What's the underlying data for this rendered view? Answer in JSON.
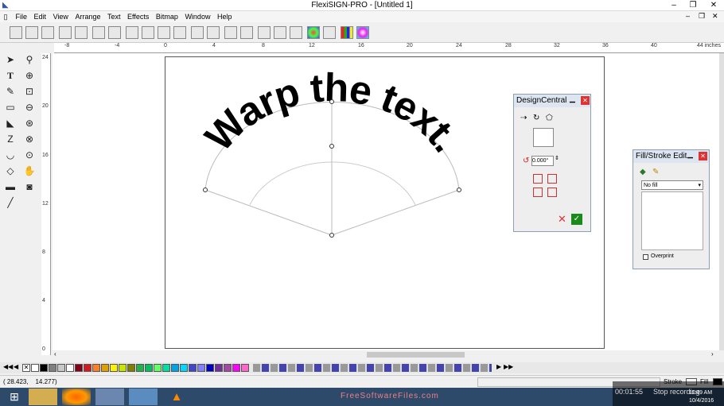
{
  "window": {
    "title": "FlexiSIGN-PRO - [Untitled 1]"
  },
  "menu": [
    "File",
    "Edit",
    "View",
    "Arrange",
    "Text",
    "Effects",
    "Bitmap",
    "Window",
    "Help"
  ],
  "ruler": {
    "top_labels": [
      "-8",
      "-4",
      "0",
      "4",
      "8",
      "12",
      "16",
      "20",
      "24",
      "28",
      "32",
      "36",
      "40",
      "44 inches"
    ],
    "left_labels": [
      "24",
      "20",
      "16",
      "12",
      "8",
      "4",
      "0"
    ]
  },
  "canvas": {
    "warp_text": "Warp the text."
  },
  "design_central": {
    "title": "DesignCentral",
    "angle": "0.000°"
  },
  "fill_stroke": {
    "title": "Fill/Stroke Edit",
    "fill_value": "No fill",
    "overprint_label": "Overprint"
  },
  "status": {
    "coords": "( 28.423,    14.277)",
    "stroke": "Stroke",
    "fill": "Fill"
  },
  "taskbar": {
    "watermark": "FreeSoftwareFiles.com",
    "rec_time": "00:01:55",
    "rec_label": "Stop recording",
    "time": "11:49 AM",
    "date": "10/4/2016"
  },
  "colors": {
    "accent": "#2d4a6b",
    "close_red": "#d33333",
    "ok_green": "#1a8a1a"
  },
  "palette_colors": [
    "#ffffff",
    "#000000",
    "#7f7f7f",
    "#c8c8c8",
    "#ffffff",
    "#880015",
    "#d01c1c",
    "#ff7f27",
    "#e0a000",
    "#fff200",
    "#c8e600",
    "#808000",
    "#22b14c",
    "#00c060",
    "#66ff66",
    "#00e0a0",
    "#00a2e8",
    "#00d8ff",
    "#3f48cc",
    "#8080ff",
    "#0000c0",
    "#7030a0",
    "#a349a4",
    "#ff00ff",
    "#ff66cc",
    "#ff2080"
  ]
}
